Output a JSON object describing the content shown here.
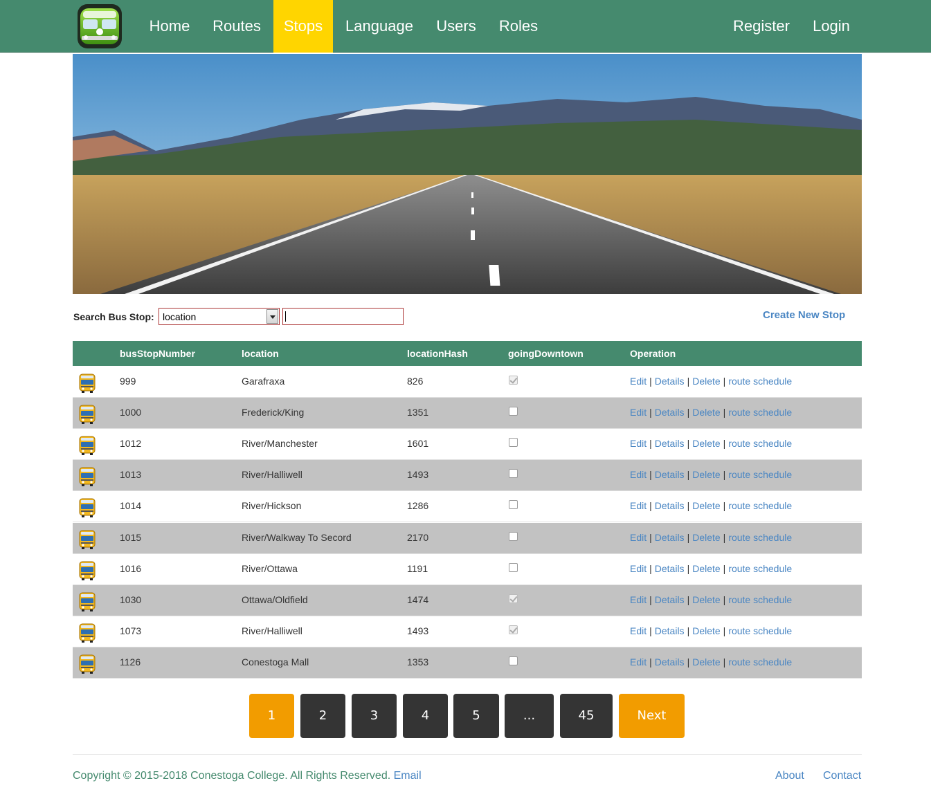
{
  "nav": {
    "items": [
      {
        "label": "Home"
      },
      {
        "label": "Routes"
      },
      {
        "label": "Stops",
        "active": true
      },
      {
        "label": "Language"
      },
      {
        "label": "Users"
      },
      {
        "label": "Roles"
      }
    ],
    "register": "Register",
    "login": "Login",
    "colors": {
      "bar": "#458a6e",
      "active": "#ffd500"
    }
  },
  "search": {
    "label": "Search Bus Stop:",
    "field_value": "location",
    "input_value": "",
    "create_link": "Create New Stop"
  },
  "table": {
    "headers": [
      "busStopNumber",
      "location",
      "locationHash",
      "goingDowntown",
      "Operation"
    ],
    "rows": [
      {
        "busStopNumber": "999",
        "location": "Garafraxa",
        "locationHash": "826",
        "goingDowntown": true
      },
      {
        "busStopNumber": "1000",
        "location": "Frederick/King",
        "locationHash": "1351",
        "goingDowntown": false
      },
      {
        "busStopNumber": "1012",
        "location": "River/Manchester",
        "locationHash": "1601",
        "goingDowntown": false
      },
      {
        "busStopNumber": "1013",
        "location": "River/Halliwell",
        "locationHash": "1493",
        "goingDowntown": false
      },
      {
        "busStopNumber": "1014",
        "location": "River/Hickson",
        "locationHash": "1286",
        "goingDowntown": false
      },
      {
        "busStopNumber": "1015",
        "location": "River/Walkway To Secord",
        "locationHash": "2170",
        "goingDowntown": false
      },
      {
        "busStopNumber": "1016",
        "location": "River/Ottawa",
        "locationHash": "1191",
        "goingDowntown": false
      },
      {
        "busStopNumber": "1030",
        "location": "Ottawa/Oldfield",
        "locationHash": "1474",
        "goingDowntown": true
      },
      {
        "busStopNumber": "1073",
        "location": "River/Halliwell",
        "locationHash": "1493",
        "goingDowntown": true
      },
      {
        "busStopNumber": "1126",
        "location": "Conestoga Mall",
        "locationHash": "1353",
        "goingDowntown": false
      }
    ],
    "operations": {
      "edit": "Edit",
      "details": "Details",
      "delete": "Delete",
      "schedule": "route schedule",
      "separator": "|"
    }
  },
  "pagination": {
    "pages": [
      "1",
      "2",
      "3",
      "4",
      "5",
      "...",
      "45"
    ],
    "current": "1",
    "next": "Next"
  },
  "footer": {
    "copyright": "Copyright © 2015-2018 Conestoga College. All Rights Reserved.",
    "email": "Email",
    "about": "About",
    "contact": "Contact"
  }
}
